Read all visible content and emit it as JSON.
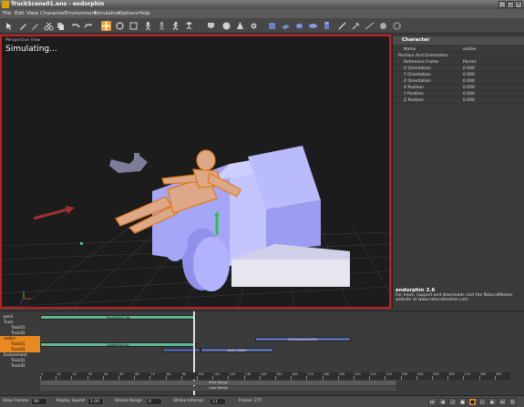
{
  "window": {
    "title": "TruckScene01.ens - endorphin",
    "controls": [
      "_",
      "□",
      "×"
    ]
  },
  "menu": [
    "File",
    "Edit",
    "View",
    "Character",
    "Environment",
    "Simulation",
    "Options",
    "Help"
  ],
  "viewport": {
    "label": "Perspective View",
    "status": "Simulating..."
  },
  "panel": {
    "header": "Character",
    "rows": [
      {
        "key": "Name",
        "value": "soldier"
      },
      {
        "key": "Position And Orientation",
        "value": ""
      },
      {
        "key": "Reference Frame",
        "value": "Parent"
      },
      {
        "key": "X Orientation",
        "value": "0.000"
      },
      {
        "key": "Y Orientation",
        "value": "0.000"
      },
      {
        "key": "Z Orientation",
        "value": "0.000"
      },
      {
        "key": "X Position",
        "value": "0.000"
      },
      {
        "key": "Y Position",
        "value": "0.000"
      },
      {
        "key": "Z Position",
        "value": "0.000"
      }
    ],
    "about_title": "endorphin 2.6",
    "about_text": "For news, support and downloads visit the NaturalMotion website at www.naturalmotion.com"
  },
  "timeline": {
    "tracks": [
      {
        "label": "pen3",
        "indent": 0
      },
      {
        "label": "Truck",
        "indent": 0
      },
      {
        "label": "Track01",
        "indent": 1
      },
      {
        "label": "Track02",
        "indent": 1
      },
      {
        "label": "soldier",
        "indent": 0,
        "selected": true
      },
      {
        "label": "Track01",
        "indent": 1,
        "selected": true
      },
      {
        "label": "Track02",
        "indent": 1,
        "selected": true
      },
      {
        "label": "Environment",
        "indent": 0
      },
      {
        "label": "Track01",
        "indent": 1
      },
      {
        "label": "Track02",
        "indent": 1
      }
    ],
    "clips": [
      {
        "text": "TruckPath01.Bc",
        "row": 0
      },
      {
        "text": "AnimationEvent01",
        "row": 4
      },
      {
        "text": "SoldierRun.Bc",
        "row": 5
      },
      {
        "text": "Body Stable",
        "row": 6
      }
    ],
    "ticks": [
      "0",
      "10",
      "20",
      "30",
      "40",
      "50",
      "60",
      "70",
      "80",
      "90",
      "100",
      "110",
      "120",
      "130",
      "140",
      "150",
      "160",
      "170",
      "180",
      "190",
      "200",
      "210",
      "220",
      "230",
      "240",
      "250",
      "260",
      "270",
      "280",
      "290"
    ],
    "save_range": "Save Range",
    "loop_range": "Loop Range"
  },
  "status": {
    "view_frames_label": "View Frames",
    "view_frames_value": "90",
    "replay_speed_label": "Replay Speed",
    "replay_speed_value": "1.00",
    "stroke_range_label": "Stroke Range",
    "stroke_range_value": "0",
    "stroke_interval_label": "Stroke Interval",
    "stroke_interval_value": "11",
    "frame_label": "Frame: 277"
  },
  "colors": {
    "accent": "#e8961e",
    "selection_border": "#c02020",
    "truck": "#a0a0ff",
    "clip_green": "#5fb890",
    "clip_blue": "#5a6aa8"
  }
}
